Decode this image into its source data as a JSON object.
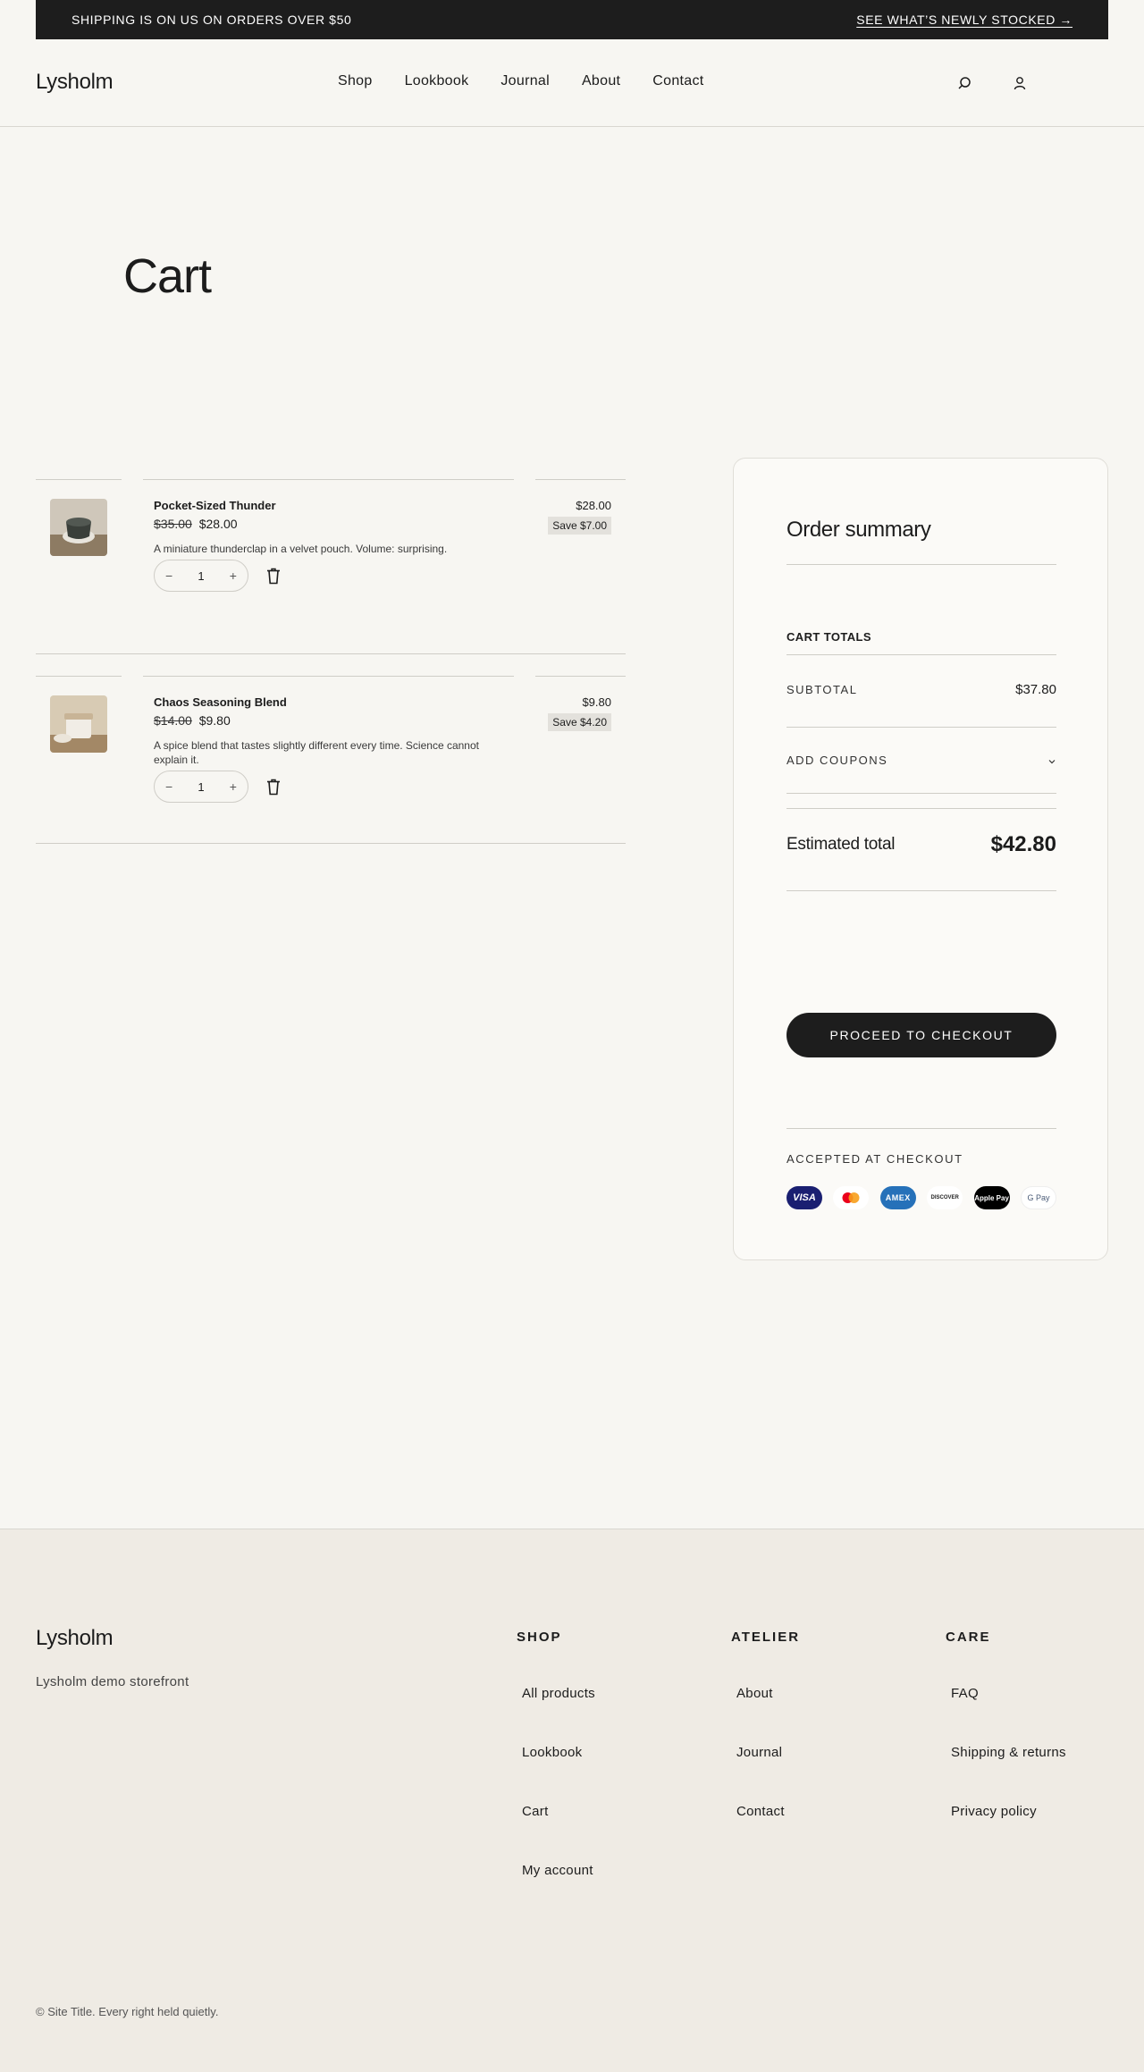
{
  "announcement": {
    "text": "SHIPPING IS ON US ON ORDERS OVER $50",
    "link": "SEE WHAT’S NEWLY STOCKED →"
  },
  "header": {
    "logo": "Lysholm",
    "nav": [
      "Shop",
      "Lookbook",
      "Journal",
      "About",
      "Contact"
    ],
    "icons": [
      "search-icon",
      "account-icon"
    ]
  },
  "page": {
    "title": "Cart"
  },
  "cart": {
    "items": [
      {
        "name": "Pocket-Sized Thunder",
        "old_price": "$35.00",
        "price": "$28.00",
        "description": "A miniature thunderclap in a velvet pouch. Volume: surprising.",
        "quantity": "1",
        "total": "$28.00",
        "save": "Save $7.00",
        "decrease": "−",
        "increase": "+"
      },
      {
        "name": "Chaos Seasoning Blend",
        "old_price": "$14.00",
        "price": "$9.80",
        "description": "A spice blend that tastes slightly different every time. Science cannot explain it.",
        "quantity": "1",
        "total": "$9.80",
        "save": "Save $4.20",
        "decrease": "−",
        "increase": "+"
      }
    ]
  },
  "summary": {
    "title": "Order summary",
    "cart_totals": "CART TOTALS",
    "subtotal_label": "SUBTOTAL",
    "subtotal_value": "$37.80",
    "coupons_label": "ADD COUPONS",
    "estimated_label": "Estimated total",
    "estimated_value": "$42.80",
    "checkout": "PROCEED TO CHECKOUT",
    "accepted": "ACCEPTED AT CHECKOUT",
    "payments": [
      "VISA",
      "Mastercard",
      "AMEX",
      "DISCOVER",
      "Apple Pay",
      "G Pay"
    ]
  },
  "footer": {
    "logo": "Lysholm",
    "tagline": "Lysholm demo storefront",
    "columns": [
      {
        "title": "SHOP",
        "links": [
          "All products",
          "Lookbook",
          "Cart",
          "My account"
        ]
      },
      {
        "title": "ATELIER",
        "links": [
          "About",
          "Journal",
          "Contact"
        ]
      },
      {
        "title": "CARE",
        "links": [
          "FAQ",
          "Shipping & returns",
          "Privacy policy"
        ]
      }
    ],
    "copyright": "© Site Title. Every right held quietly."
  },
  "colors": {
    "background": "#f7f6f2",
    "dark": "#1d1d1d",
    "footer_bg": "#efebe4",
    "badge_bg": "#e3e1dc"
  }
}
